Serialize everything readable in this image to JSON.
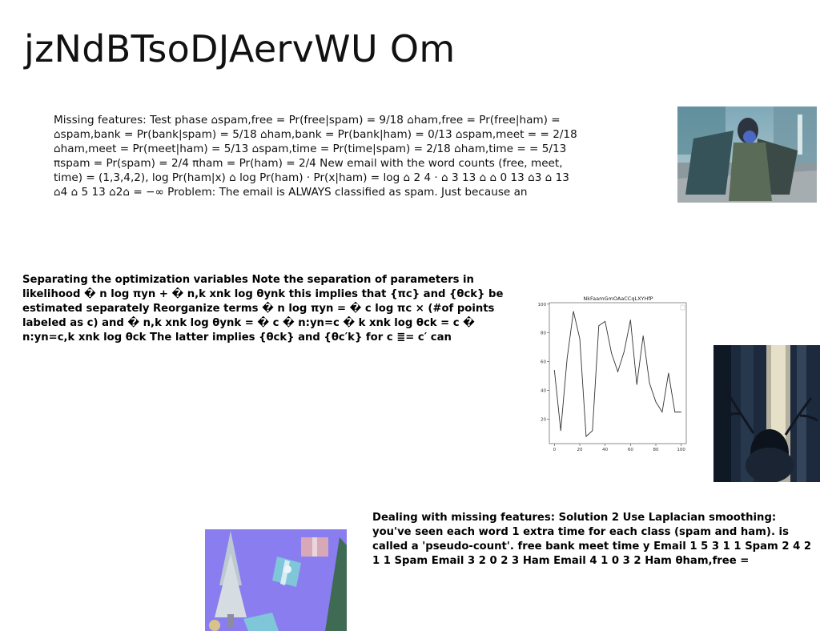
{
  "title": "jzNdBTsoDJAervWU Om",
  "paragraph_1": "Missing features: Test phase ⌂spam,free = Pr(free|spam) = 9/18 ⌂ham,free = Pr(free|ham) = ⌂spam,bank = Pr(bank|spam) = 5/18 ⌂ham,bank = Pr(bank|ham) = 0/13 ⌂spam,meet = = 2/18 ⌂ham,meet = Pr(meet|ham) = 5/13 ⌂spam,time = Pr(time|spam) = 2/18 ⌂ham,time = = 5/13 πspam = Pr(spam) = 2/4 πham = Pr(ham) = 2/4 New email with the word counts (free, meet, time) = (1,3,4,2), log Pr(ham|x) ⌂ log Pr(ham) · Pr(x|ham) = log ⌂ 2 4 · ⌂ 3 13 ⌂ ⌂ 0 13 ⌂3 ⌂ 13 ⌂4 ⌂ 5 13 ⌂2⌂ = −∞ Problem: The email is ALWAYS classified as spam. Just because an",
  "paragraph_2": "Separating the optimization variables Note the separation of parameters in likelihood � n log πyn + � n,k xnk log θynk this implies that {πc} and {θck} be estimated separately Reorganize terms � n log πyn = � c log πc × (#of points labeled as c) and � n,k xnk log θynk = � c � n:yn=c � k xnk log θck = c � n:yn=c,k xnk log θck The latter implies {θck} and {θc′k} for c ≣= c′ can",
  "paragraph_3": "Dealing with missing features: Solution 2 Use Laplacian smoothing: you've seen each word 1 extra time for each class (spam and ham). is called a 'pseudo-count'. free bank meet time y Email 1 5 3 1 1 Spam 2 4 2 1 1 Spam Email 3 2 0 2 3 Ham Email 4 1 0 3 2 Ham θham,free =",
  "chart_data": {
    "type": "line",
    "title": "NkFaamGmOAaCCqLXYHfP",
    "xlabel": "",
    "ylabel": "",
    "x": [
      0,
      5,
      10,
      15,
      20,
      25,
      30,
      35,
      40,
      45,
      50,
      55,
      60,
      65,
      70,
      75,
      80,
      85,
      90,
      95,
      100
    ],
    "y": [
      54,
      12,
      62,
      95,
      76,
      8,
      12,
      85,
      88,
      66,
      53,
      67,
      89,
      44,
      78,
      45,
      32,
      25,
      52,
      25,
      25
    ],
    "xticks": [
      0,
      20,
      40,
      60,
      80,
      100
    ],
    "yticks": [
      20,
      40,
      60,
      80,
      100
    ],
    "xlim": [
      -4,
      104
    ],
    "ylim": [
      3,
      101
    ],
    "grid": false,
    "legend": "top-right",
    "line_color": "#333333"
  }
}
